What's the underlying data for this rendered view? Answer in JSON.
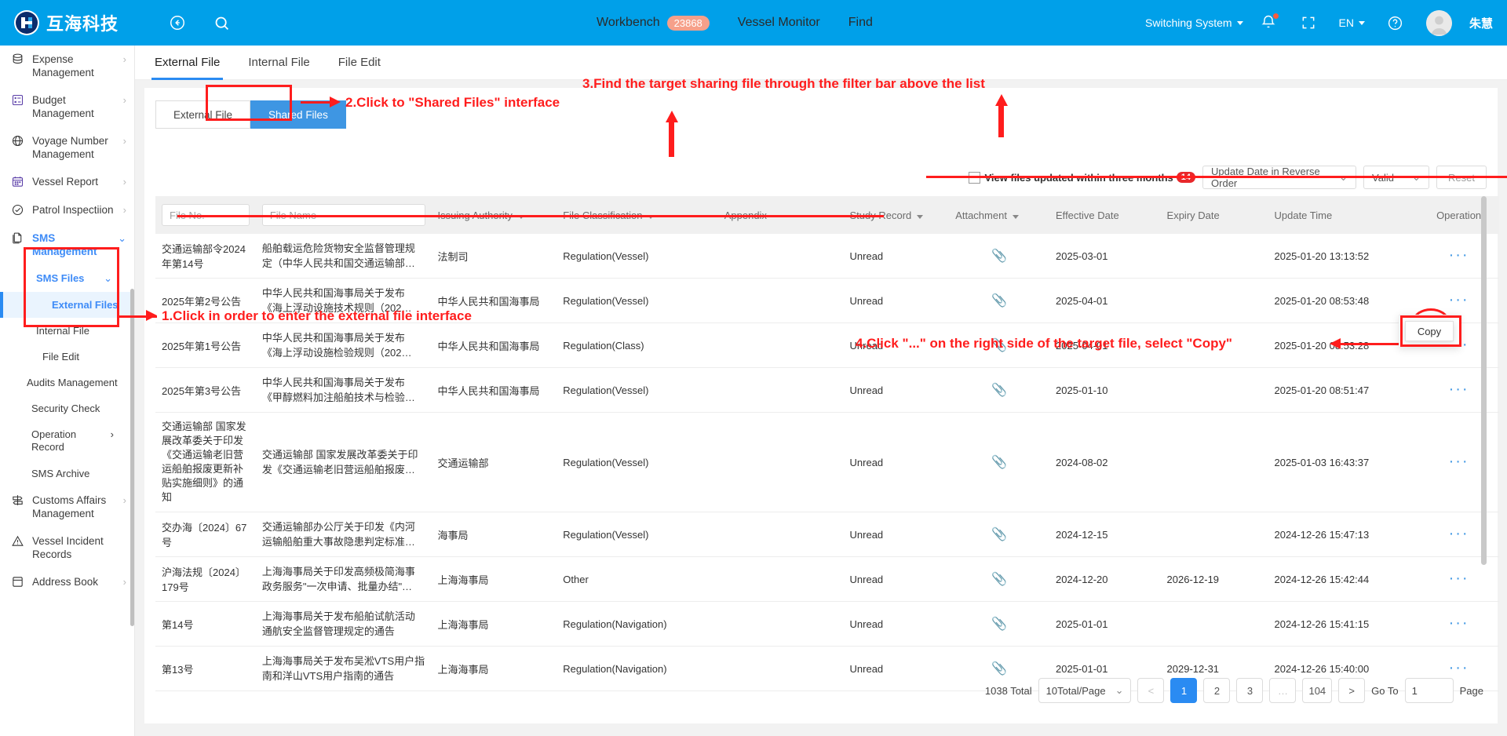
{
  "app": {
    "brand": "互海科技",
    "user_name": "朱慧"
  },
  "topbar": {
    "back_icon": "back-arrow-icon",
    "search_icon": "search-icon",
    "nav": [
      {
        "label": "Workbench",
        "badge": "23868"
      },
      {
        "label": "Vessel Monitor",
        "badge": ""
      },
      {
        "label": "Find",
        "badge": ""
      }
    ],
    "switching_system": "Switching System",
    "language": "EN",
    "bell_icon": "bell-icon",
    "fullscreen_icon": "fullscreen-icon",
    "help_icon": "help-circle-icon"
  },
  "sidebar": {
    "items": [
      {
        "label": "Expense Management",
        "icon": "database-icon",
        "arrow": "›",
        "level": 1
      },
      {
        "label": "Budget Management",
        "icon": "budget-icon",
        "arrow": "›",
        "level": 1
      },
      {
        "label": "Voyage Number Management",
        "icon": "globe-icon",
        "arrow": "›",
        "level": 1
      },
      {
        "label": "Vessel Report",
        "icon": "calendar-icon",
        "arrow": "›",
        "level": 1
      },
      {
        "label": "Patrol Inspectiion",
        "icon": "check-circle-icon",
        "arrow": "›",
        "level": 1
      },
      {
        "label": "SMS Management",
        "icon": "documents-icon",
        "arrow": "⌄",
        "level": 1
      },
      {
        "label": "SMS Files",
        "arrow": "⌄",
        "level": 2
      },
      {
        "label": "External Files",
        "arrow": "",
        "level": 3
      },
      {
        "label": "Internal File",
        "arrow": "",
        "level": 2
      },
      {
        "label": "File Edit",
        "arrow": "",
        "level": 2
      },
      {
        "label": "Audits Management",
        "arrow": "",
        "level": 2
      },
      {
        "label": "Security Check",
        "arrow": "",
        "level": 2
      },
      {
        "label": "Operation Record",
        "arrow": "›",
        "level": 2
      },
      {
        "label": "SMS Archive",
        "arrow": "",
        "level": 2
      },
      {
        "label": "Customs Affairs Management",
        "icon": "signpost-icon",
        "arrow": "›",
        "level": 1
      },
      {
        "label": "Vessel Incident Records",
        "icon": "warning-icon",
        "arrow": "",
        "level": 1
      },
      {
        "label": "Address Book",
        "icon": "book-icon",
        "arrow": "›",
        "level": 1
      }
    ]
  },
  "main": {
    "tabs": [
      {
        "label": "External File",
        "active": true
      },
      {
        "label": "Internal File",
        "active": false
      },
      {
        "label": "File Edit",
        "active": false
      }
    ],
    "segments": [
      {
        "label": "External File",
        "selected": false
      },
      {
        "label": "Shared Files",
        "selected": true
      }
    ],
    "filter": {
      "checkbox_label": "View files updated within three months",
      "checkbox_badge": "14",
      "sort_value": "Update Date in Reverse Order",
      "status_value": "Valid",
      "reset_label": "Reset"
    },
    "table": {
      "headers": [
        {
          "label": "File No.",
          "type": "input",
          "placeholder": "File No."
        },
        {
          "label": "File Name",
          "type": "input",
          "placeholder": "File Name"
        },
        {
          "label": "Issuing Authority",
          "type": "dropdown"
        },
        {
          "label": "File Classification",
          "type": "dropdown"
        },
        {
          "label": "Appendix",
          "type": "plain"
        },
        {
          "label": "Study Record",
          "type": "dropdown"
        },
        {
          "label": "Attachment",
          "type": "dropdown"
        },
        {
          "label": "Effective Date",
          "type": "plain"
        },
        {
          "label": "Expiry Date",
          "type": "plain"
        },
        {
          "label": "Update Time",
          "type": "plain"
        },
        {
          "label": "Operation",
          "type": "plain"
        }
      ],
      "rows": [
        {
          "file_no": "交通运输部令2024年第14号",
          "file_name": "船舶载运危险货物安全监督管理规定（中华人民共和国交通运输部…",
          "issuing_authority": "法制司",
          "classification": "Regulation(Vessel)",
          "appendix": "",
          "study_record": "Unread",
          "attachment": "paperclip-icon",
          "effective_date": "2025-03-01",
          "expiry_date": "",
          "update_time": "2025-01-20 13:13:52",
          "operation": "···"
        },
        {
          "file_no": "2025年第2号公告",
          "file_name": "中华人民共和国海事局关于发布《海上浮动设施技术规则（202…",
          "issuing_authority": "中华人民共和国海事局",
          "classification": "Regulation(Vessel)",
          "appendix": "",
          "study_record": "Unread",
          "attachment": "paperclip-icon",
          "effective_date": "2025-04-01",
          "expiry_date": "",
          "update_time": "2025-01-20 08:53:48",
          "operation": "···"
        },
        {
          "file_no": "2025年第1号公告",
          "file_name": "中华人民共和国海事局关于发布《海上浮动设施检验规则（202…",
          "issuing_authority": "中华人民共和国海事局",
          "classification": "Regulation(Class)",
          "appendix": "",
          "study_record": "Unread",
          "attachment": "paperclip-icon",
          "effective_date": "2025-04-01",
          "expiry_date": "",
          "update_time": "2025-01-20 08:53:28",
          "operation": "···"
        },
        {
          "file_no": "2025年第3号公告",
          "file_name": "中华人民共和国海事局关于发布《甲醇燃料加注船舶技术与检验…",
          "issuing_authority": "中华人民共和国海事局",
          "classification": "Regulation(Vessel)",
          "appendix": "",
          "study_record": "Unread",
          "attachment": "paperclip-icon",
          "effective_date": "2025-01-10",
          "expiry_date": "",
          "update_time": "2025-01-20 08:51:47",
          "operation": "···"
        },
        {
          "file_no": "交通运输部 国家发展改革委关于印发《交通运输老旧营运船舶报废更新补贴实施细则》的通知",
          "file_name": "交通运输部 国家发展改革委关于印发《交通运输老旧营运船舶报废…",
          "issuing_authority": "交通运输部",
          "classification": "Regulation(Vessel)",
          "appendix": "",
          "study_record": "Unread",
          "attachment": "paperclip-icon",
          "effective_date": "2024-08-02",
          "expiry_date": "",
          "update_time": "2025-01-03 16:43:37",
          "operation": "···"
        },
        {
          "file_no": "交办海〔2024〕67号",
          "file_name": "交通运输部办公厅关于印发《内河运输船舶重大事故隐患判定标准…",
          "issuing_authority": "海事局",
          "classification": "Regulation(Vessel)",
          "appendix": "",
          "study_record": "Unread",
          "attachment": "paperclip-icon",
          "effective_date": "2024-12-15",
          "expiry_date": "",
          "update_time": "2024-12-26 15:47:13",
          "operation": "···"
        },
        {
          "file_no": "沪海法规〔2024〕179号",
          "file_name": "上海海事局关于印发高频极简海事政务服务\"一次申请、批量办结\"…",
          "issuing_authority": "上海海事局",
          "classification": "Other",
          "appendix": "",
          "study_record": "Unread",
          "attachment": "paperclip-icon",
          "effective_date": "2024-12-20",
          "expiry_date": "2026-12-19",
          "update_time": "2024-12-26 15:42:44",
          "operation": "···"
        },
        {
          "file_no": "第14号",
          "file_name": "上海海事局关于发布船舶试航活动通航安全监督管理规定的通告",
          "issuing_authority": "上海海事局",
          "classification": "Regulation(Navigation)",
          "appendix": "",
          "study_record": "Unread",
          "attachment": "paperclip-icon",
          "effective_date": "2025-01-01",
          "expiry_date": "",
          "update_time": "2024-12-26 15:41:15",
          "operation": "···"
        },
        {
          "file_no": "第13号",
          "file_name": "上海海事局关于发布吴淞VTS用户指南和洋山VTS用户指南的通告",
          "issuing_authority": "上海海事局",
          "classification": "Regulation(Navigation)",
          "appendix": "",
          "study_record": "Unread",
          "attachment": "paperclip-icon",
          "effective_date": "2025-01-01",
          "expiry_date": "2029-12-31",
          "update_time": "2024-12-26 15:40:00",
          "operation": "···"
        }
      ]
    },
    "pagination": {
      "total": "1038 Total",
      "page_size": "10Total/Page",
      "prev": "<",
      "pages": [
        "1",
        "2",
        "3",
        "…",
        "104"
      ],
      "next": ">",
      "goto_label": "Go To",
      "goto_value": "1",
      "page_label": "Page",
      "current": "1"
    },
    "context_menu": {
      "copy": "Copy"
    }
  },
  "annotations": [
    {
      "id": "step1",
      "text": "1.Click in order to enter the external file interface"
    },
    {
      "id": "step2",
      "text": "2.Click to \"Shared Files\" interface"
    },
    {
      "id": "step3",
      "text": "3.Find the target sharing file through the filter bar above the list"
    },
    {
      "id": "step4",
      "text": "4.Click \"...\" on the right side of the target file, select \"Copy\""
    }
  ],
  "colors": {
    "brand_blue": "#00A0E9",
    "accent_blue": "#2a8bf2",
    "annotation_red": "#FF1D1D",
    "badge_orange": "#F6A08A",
    "badge_red": "#E8282B"
  }
}
